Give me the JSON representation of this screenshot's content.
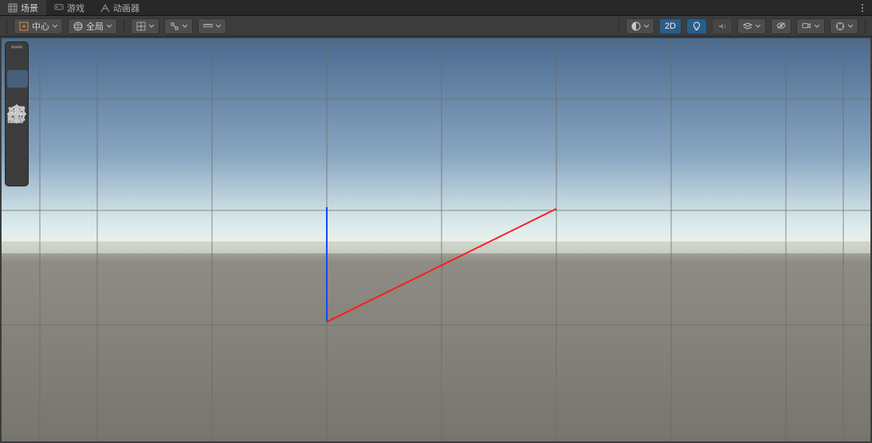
{
  "tabs": {
    "scene": "场景",
    "game": "游戏",
    "animator": "动画器"
  },
  "toolbar": {
    "pivot": {
      "label": "中心"
    },
    "space": {
      "label": "全局"
    },
    "mode2d": "2D"
  },
  "icons": {
    "scene_tab": "grid",
    "game_tab": "gamepad",
    "animator_tab": "animator",
    "kebab": "more-vert",
    "pivot": "pivot",
    "globe": "globe",
    "grid_snap": "grid-snap",
    "snap_inc": "snap-increment",
    "ruler": "ruler",
    "shading_menu": "shading",
    "light": "light-bulb",
    "audio": "audio",
    "fx": "fx-stack",
    "hidden": "eye-off",
    "camera": "camera",
    "gizmos": "gizmos",
    "hand": "hand",
    "move": "move",
    "rotate": "rotate",
    "scale": "scale",
    "rect": "rect",
    "transform": "transform",
    "custom": "custom-tool"
  }
}
